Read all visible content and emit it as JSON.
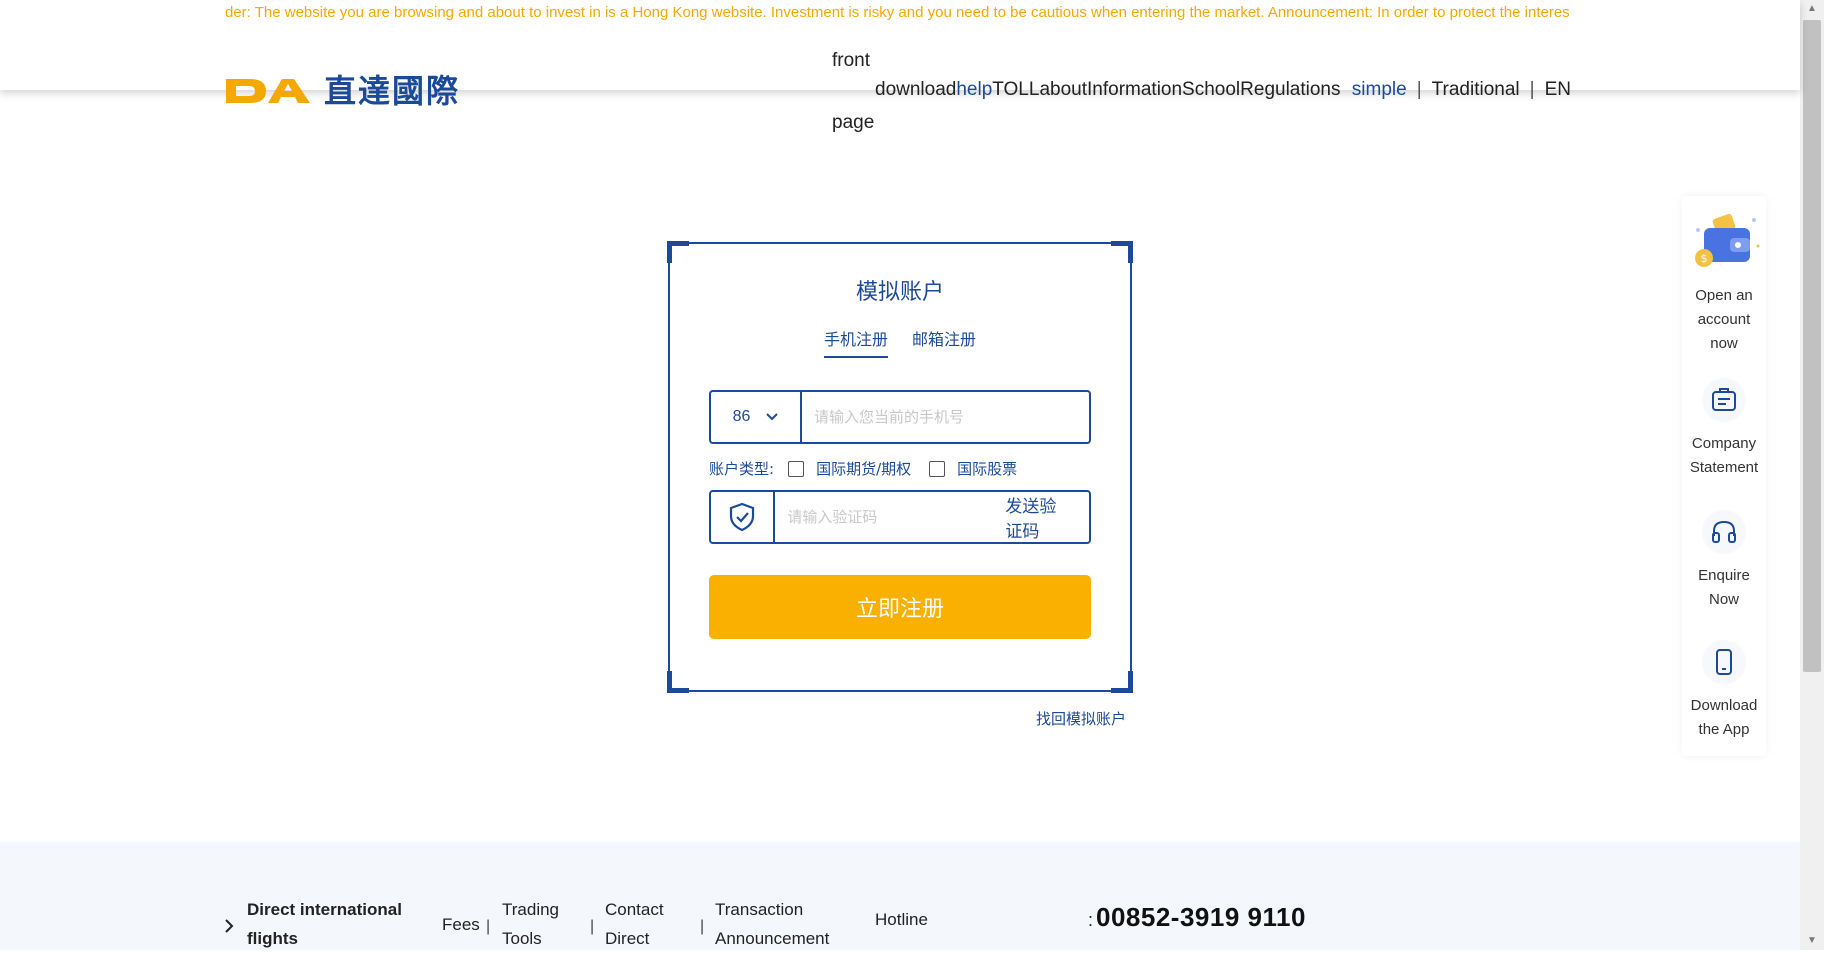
{
  "header": {
    "notice": "der: The website you are browsing and about to invest in is a Hong Kong website. Investment is risky and you need to be cautious when entering the market. Announcement: In order to protect the interests of",
    "logo_text": "直達國際",
    "nav": {
      "front": "front",
      "page": "page",
      "download": "download",
      "help": "help",
      "toll": "TOLL",
      "about": "about",
      "information": "Information",
      "school": "School",
      "regulations": "Regulations",
      "lang_simple": "simple",
      "lang_traditional": "Traditional",
      "lang_en": "EN",
      "separator": "|"
    }
  },
  "register": {
    "title": "模拟账户",
    "tabs": [
      "手机注册",
      "邮箱注册"
    ],
    "country_code": "86",
    "phone_placeholder": "请输入您当前的手机号",
    "account_type_label": "账户类型:",
    "account_options": [
      "国际期货/期权",
      "国际股票"
    ],
    "code_placeholder": "请输入验证码",
    "send_code": "发送验证码",
    "submit": "立即注册",
    "retrieve": "找回模拟账户"
  },
  "side_panel": [
    {
      "label_lines": [
        "Open an",
        "account",
        "now"
      ],
      "icon": "wallet-icon"
    },
    {
      "label_lines": [
        "Company",
        "Statement"
      ],
      "icon": "clipboard-icon"
    },
    {
      "label_lines": [
        "Enquire",
        "Now"
      ],
      "icon": "headset-icon"
    },
    {
      "label_lines": [
        "Download",
        "the App"
      ],
      "icon": "mobile-icon"
    }
  ],
  "footer": {
    "items": [
      [
        "Direct international",
        "flights"
      ],
      [
        "Fees"
      ],
      [
        "Trading",
        "Tools"
      ],
      [
        "Contact",
        "Direct"
      ],
      [
        "Transaction",
        "Announcement"
      ]
    ],
    "hotline_label": "Hotline",
    "hotline_colon": ":",
    "hotline_number": "00852-3919 9110",
    "separator": "|"
  },
  "colors": {
    "brand_blue": "#1c4a9a",
    "accent_yellow": "#fab000",
    "notice_text": "#f5a800",
    "footer_bg": "#f4f7fc"
  }
}
